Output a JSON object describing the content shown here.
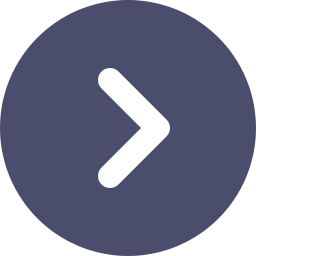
{
  "button": {
    "icon": "chevron-right-icon",
    "background_color": "#4a4d6c",
    "icon_color": "#ffffff"
  }
}
